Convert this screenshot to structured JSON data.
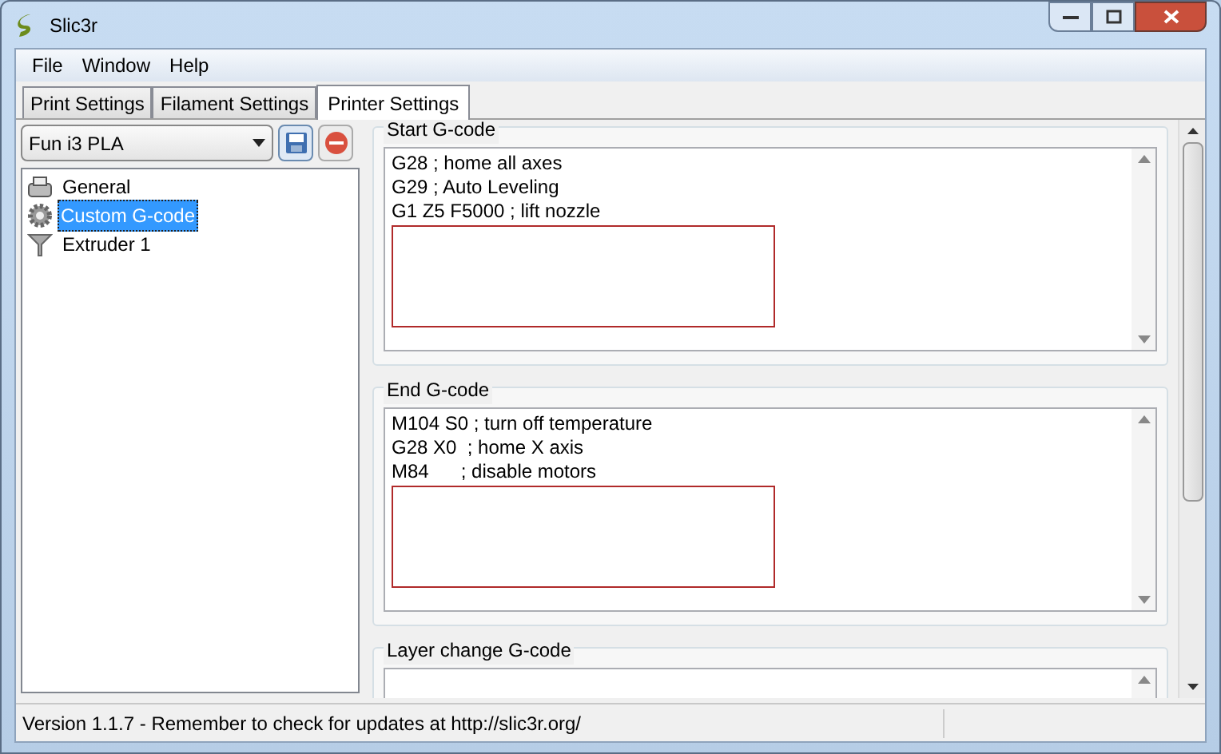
{
  "window": {
    "title": "Slic3r"
  },
  "menu": [
    "File",
    "Window",
    "Help"
  ],
  "tabs": [
    {
      "label": "Print Settings",
      "selected": false
    },
    {
      "label": "Filament Settings",
      "selected": false
    },
    {
      "label": "Printer Settings",
      "selected": true
    }
  ],
  "preset": {
    "value": "Fun i3 PLA"
  },
  "tree": [
    {
      "label": "General",
      "kind": "printer",
      "selected": false
    },
    {
      "label": "Custom G-code",
      "kind": "gear",
      "selected": true
    },
    {
      "label": "Extruder 1",
      "kind": "funnel",
      "selected": false
    }
  ],
  "sections": [
    {
      "title": "Start G-code",
      "lines": [
        "G28 ; home all axes",
        "G29 ; Auto Leveling",
        "G1 Z5 F5000 ; lift nozzle"
      ],
      "annotated": true
    },
    {
      "title": "End G-code",
      "lines": [
        "M104 S0 ; turn off temperature",
        "G28 X0  ; home X axis",
        "M84      ; disable motors"
      ],
      "annotated": true
    },
    {
      "title": "Layer change G-code",
      "annotated": false
    }
  ],
  "status_bar": "Version 1.1.7 - Remember to check for updates at http://slic3r.org/"
}
